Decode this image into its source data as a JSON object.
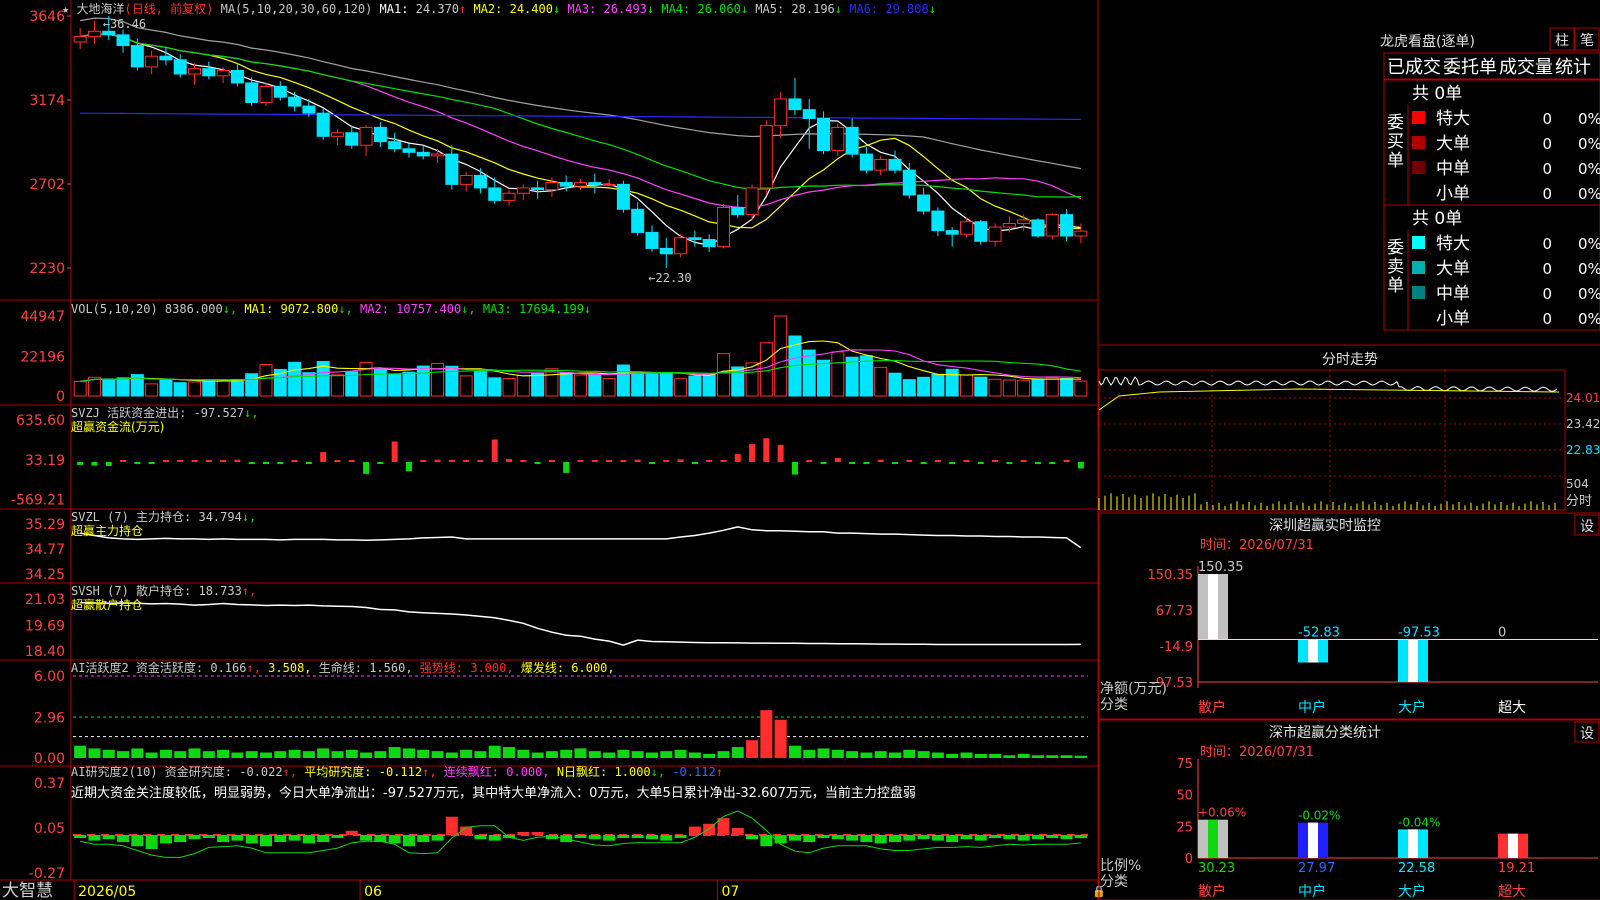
{
  "colors": {
    "up": "#ff2d2d",
    "down": "#00e5ff",
    "green": "#10d810",
    "grid": "#b00000",
    "ma1": "#ffffff",
    "ma2": "#ffff00",
    "ma3": "#ff40ff",
    "ma4": "#00e000",
    "ma5": "#a0a0a0",
    "ma6": "#2a2aff",
    "axis_text": "#ff4040",
    "label": "#c8c8c8",
    "yellow_label": "#ffff00"
  },
  "main_chart": {
    "title_text": "大地海洋",
    "mode_label": "(日线, 前复权)",
    "ma_params": "MA(5,10,20,30,60,120)",
    "ma_values": [
      {
        "name": "MA1:",
        "value": "24.370",
        "arrow": "↑"
      },
      {
        "name": "MA2:",
        "value": "24.400",
        "arrow": "↓"
      },
      {
        "name": "MA3:",
        "value": "26.493",
        "arrow": "↓"
      },
      {
        "name": "MA4:",
        "value": "26.060",
        "arrow": "↓"
      },
      {
        "name": "MA5:",
        "value": "28.196",
        "arrow": "↓"
      },
      {
        "name": "MA6:",
        "value": "29.808",
        "arrow": "↓"
      }
    ],
    "y_ticks": [
      "3646",
      "3174",
      "2702",
      "2230"
    ],
    "y_tick_values": [
      36.46,
      31.74,
      27.02,
      22.3
    ],
    "high_note": "←36.46",
    "low_note": "←22.30"
  },
  "volume": {
    "label": "VOL(5,10,20)",
    "current": "8386.000",
    "current_arrow": "↓",
    "ma_values": [
      {
        "name": "MA1:",
        "value": "9072.800",
        "arrow": "↓"
      },
      {
        "name": "MA2:",
        "value": "10757.400",
        "arrow": "↓"
      },
      {
        "name": "MA3:",
        "value": "17694.199",
        "arrow": "↓"
      }
    ],
    "y_ticks": [
      "44947",
      "22196",
      "0"
    ]
  },
  "svzj": {
    "label": "SVZJ  活跃资金进出:",
    "value": "-97.527",
    "arrow": "↓",
    "suffix": ",",
    "sub_label": "超赢资金流(万元)",
    "y_ticks": [
      "635.60",
      "33.19",
      "-569.21"
    ]
  },
  "svzl": {
    "label": "SVZL (7) 主力持仓:",
    "value": "34.794",
    "arrow": "↓",
    "suffix": ",",
    "sub_label": "超赢主力持仓",
    "y_ticks": [
      "35.29",
      "34.77",
      "34.25"
    ]
  },
  "svsh": {
    "label": "SVSH (7) 散户持仓:",
    "value": "18.733",
    "arrow": "↑",
    "suffix": ",",
    "sub_label": "超赢散户持仓",
    "y_ticks": [
      "21.03",
      "19.69",
      "18.40"
    ]
  },
  "ai_active": {
    "label": "AI活跃度2 资金活跃度:",
    "v1": "0.166",
    "v1_arrow": "↑",
    "v2": "3.508",
    "life_label": "生命线:",
    "life_value": "1.560",
    "strong_label": "强势线:",
    "strong_value": "3.000",
    "burst_label": "爆发线:",
    "burst_value": "6.000",
    "y_ticks": [
      "6.00",
      "2.96",
      "0.00"
    ]
  },
  "ai_research": {
    "label": "AI研究度2(10) 资金研究度:",
    "v1": "-0.022",
    "v1_arrow": "↑",
    "avg_label": "平均研究度:",
    "avg_value": "-0.112",
    "avg_arrow": "↑",
    "red_label": "连续飘红:",
    "red_value": "0.000",
    "nred_label": "N日飘红:",
    "nred_value": "1.000",
    "nred_arrow": "↓",
    "last_value": "-0.112",
    "last_arrow": "↑",
    "comment": "近期大资金关注度较低，明显弱势，今日大单净流出：-97.527万元，其中特大单净流入：0万元，大单5日累计净出-32.607万元，当前主力控盘弱",
    "y_ticks": [
      "0.37",
      "0.05",
      "-0.27"
    ]
  },
  "bottom_bar": {
    "brand": "大智慧",
    "date_labels": [
      "2026/05",
      "06",
      "07"
    ]
  },
  "right_panel": {
    "dragon_title": "龙虎看盘(逐单)",
    "btn_bar": "柱",
    "btn_pen": "笔",
    "tab_labels": [
      "已成交",
      "委托单",
      "成交量",
      "统计"
    ],
    "buy": {
      "side_label": "委买单",
      "total": "共 0单",
      "rows": [
        {
          "name": "特大",
          "count": "0",
          "pct": "0%",
          "color": "#ff0000"
        },
        {
          "name": "大单",
          "count": "0",
          "pct": "0%",
          "color": "#b00000"
        },
        {
          "name": "中单",
          "count": "0",
          "pct": "0%",
          "color": "#700000"
        },
        {
          "name": "小单",
          "count": "0",
          "pct": "0%",
          "color": "#000000"
        }
      ]
    },
    "sell": {
      "side_label": "委卖单",
      "total": "共 0单",
      "rows": [
        {
          "name": "特大",
          "count": "0",
          "pct": "0%",
          "color": "#00ffff"
        },
        {
          "name": "大单",
          "count": "0",
          "pct": "0%",
          "color": "#00b0b0"
        },
        {
          "name": "中单",
          "count": "0",
          "pct": "0%",
          "color": "#008080"
        },
        {
          "name": "小单",
          "count": "0",
          "pct": "0%",
          "color": "#000000"
        }
      ]
    },
    "intraday": {
      "title": "分时走势",
      "price_ticks": [
        "24.01",
        "23.42",
        "22.83"
      ],
      "vol_tick": "504",
      "vol_unit": "分时"
    },
    "monitor": {
      "title": "深圳超赢实时监控",
      "set_btn": "设",
      "time_label": "时间：2026/07/31",
      "y_ticks": [
        "150.35",
        "67.73",
        "-14.9",
        "-97.53"
      ],
      "y_label": "净额(万元)",
      "x_label": "分类",
      "categories": [
        "散户",
        "中户",
        "大户",
        "超大"
      ],
      "values": [
        150.35,
        -52.83,
        -97.53,
        0
      ],
      "value_labels": [
        "150.35",
        "-52.83",
        "-97.53",
        "0"
      ]
    },
    "classify": {
      "title": "深市超赢分类统计",
      "set_btn": "设",
      "time_label": "时间：2026/07/31",
      "y_ticks": [
        "75",
        "50",
        "25",
        "0"
      ],
      "y_label": "比例%",
      "x_label": "分类",
      "categories": [
        "散户",
        "中户",
        "大户",
        "超大"
      ],
      "values": [
        30.23,
        27.97,
        22.58,
        19.21
      ],
      "value_labels": [
        "30.23",
        "27.97",
        "22.58",
        "19.21"
      ],
      "change_labels": [
        "+0.06%",
        "-0.02%",
        "-0.04%",
        ""
      ]
    }
  },
  "chart_data": {
    "type": "candlestick",
    "title": "大地海洋",
    "x_labels": [
      "2026/05",
      "06",
      "07"
    ],
    "ylim": [
      22.3,
      36.46
    ],
    "ohlc": [
      [
        35.0,
        35.8,
        34.6,
        35.3
      ],
      [
        35.3,
        36.2,
        34.9,
        35.6
      ],
      [
        35.6,
        36.46,
        35.1,
        35.4
      ],
      [
        35.4,
        35.7,
        34.4,
        34.8
      ],
      [
        34.8,
        35.2,
        33.4,
        33.6
      ],
      [
        33.6,
        34.5,
        33.2,
        34.2
      ],
      [
        34.2,
        34.7,
        33.7,
        34.0
      ],
      [
        34.0,
        34.3,
        33.0,
        33.2
      ],
      [
        33.2,
        33.8,
        32.6,
        33.5
      ],
      [
        33.5,
        33.9,
        32.9,
        33.1
      ],
      [
        33.1,
        33.6,
        32.7,
        33.4
      ],
      [
        33.4,
        33.8,
        32.5,
        32.7
      ],
      [
        32.7,
        33.0,
        31.4,
        31.6
      ],
      [
        31.6,
        32.7,
        31.4,
        32.5
      ],
      [
        32.5,
        32.8,
        31.7,
        31.9
      ],
      [
        31.9,
        32.2,
        31.1,
        31.4
      ],
      [
        31.4,
        31.8,
        30.8,
        31.0
      ],
      [
        31.0,
        31.3,
        29.5,
        29.7
      ],
      [
        29.7,
        30.1,
        29.2,
        29.9
      ],
      [
        29.9,
        30.3,
        29.0,
        29.2
      ],
      [
        29.2,
        30.3,
        28.6,
        30.2
      ],
      [
        30.2,
        30.5,
        29.1,
        29.4
      ],
      [
        29.4,
        29.9,
        28.8,
        29.0
      ],
      [
        29.0,
        29.3,
        28.5,
        28.8
      ],
      [
        28.8,
        29.2,
        28.4,
        28.6
      ],
      [
        28.6,
        29.0,
        28.2,
        28.7
      ],
      [
        28.7,
        29.2,
        26.7,
        27.0
      ],
      [
        27.0,
        27.7,
        26.6,
        27.5
      ],
      [
        27.5,
        27.9,
        26.5,
        26.8
      ],
      [
        26.8,
        27.4,
        25.9,
        26.1
      ],
      [
        26.1,
        26.7,
        25.8,
        26.5
      ],
      [
        26.5,
        27.0,
        26.1,
        26.8
      ],
      [
        26.8,
        27.2,
        26.2,
        26.7
      ],
      [
        26.7,
        27.4,
        26.3,
        27.1
      ],
      [
        27.1,
        27.5,
        26.6,
        26.9
      ],
      [
        26.9,
        27.3,
        26.7,
        27.1
      ],
      [
        27.1,
        27.6,
        26.5,
        27.0
      ],
      [
        27.0,
        27.3,
        26.9,
        27.0
      ],
      [
        27.0,
        27.2,
        25.4,
        25.6
      ],
      [
        25.6,
        26.0,
        24.1,
        24.3
      ],
      [
        24.3,
        24.7,
        23.2,
        23.4
      ],
      [
        23.4,
        24.0,
        22.3,
        23.1
      ],
      [
        23.1,
        24.2,
        22.9,
        24.0
      ],
      [
        24.0,
        24.4,
        23.5,
        23.9
      ],
      [
        23.9,
        24.2,
        23.2,
        23.5
      ],
      [
        23.5,
        25.9,
        23.4,
        25.7
      ],
      [
        25.7,
        26.4,
        25.1,
        25.3
      ],
      [
        25.3,
        27.0,
        25.0,
        26.8
      ],
      [
        26.8,
        30.6,
        26.4,
        30.3
      ],
      [
        30.3,
        32.2,
        29.6,
        31.8
      ],
      [
        31.8,
        33.0,
        30.9,
        31.2
      ],
      [
        31.2,
        31.8,
        29.0,
        30.7
      ],
      [
        30.7,
        31.1,
        28.7,
        28.9
      ],
      [
        28.9,
        30.4,
        28.6,
        30.2
      ],
      [
        30.2,
        30.7,
        28.5,
        28.7
      ],
      [
        28.7,
        29.1,
        27.6,
        27.8
      ],
      [
        27.8,
        28.6,
        27.5,
        28.4
      ],
      [
        28.4,
        28.9,
        27.6,
        27.8
      ],
      [
        27.8,
        28.2,
        26.2,
        26.4
      ],
      [
        26.4,
        26.8,
        25.3,
        25.5
      ],
      [
        25.5,
        25.7,
        24.1,
        24.4
      ],
      [
        24.4,
        24.6,
        23.5,
        24.2
      ],
      [
        24.2,
        25.1,
        24.0,
        24.9
      ],
      [
        24.9,
        25.0,
        23.6,
        23.8
      ],
      [
        23.8,
        24.8,
        23.5,
        24.6
      ],
      [
        24.6,
        25.2,
        24.3,
        24.8
      ],
      [
        24.8,
        25.3,
        24.4,
        25.0
      ],
      [
        25.0,
        25.1,
        24.0,
        24.1
      ],
      [
        24.1,
        25.4,
        23.9,
        25.3
      ],
      [
        25.3,
        25.6,
        23.8,
        24.1
      ],
      [
        24.1,
        24.8,
        23.7,
        24.37
      ]
    ],
    "volume": [
      8200,
      10500,
      9600,
      10200,
      12000,
      6800,
      9300,
      7500,
      7900,
      9100,
      8400,
      9300,
      12500,
      17700,
      14900,
      18900,
      13100,
      19400,
      11900,
      13600,
      18800,
      15500,
      12100,
      13400,
      16800,
      18300,
      16700,
      11300,
      13700,
      10200,
      9800,
      11500,
      12700,
      15300,
      13100,
      11800,
      12100,
      9800,
      17400,
      13000,
      12300,
      12800,
      9700,
      11200,
      12100,
      23800,
      16300,
      18600,
      29900,
      44947,
      33700,
      25800,
      20100,
      24800,
      21800,
      22600,
      16100,
      12800,
      9200,
      10500,
      12200,
      15000,
      11800,
      10600,
      9400,
      9000,
      8900,
      9600,
      10300,
      9900,
      8386
    ],
    "svzj": [
      -45,
      -55,
      -60,
      0,
      -20,
      -15,
      20,
      25,
      30,
      25,
      30,
      35,
      -30,
      -25,
      -10,
      30,
      -15,
      150,
      20,
      25,
      -180,
      -25,
      310,
      -140,
      20,
      35,
      25,
      20,
      30,
      340,
      45,
      25,
      -20,
      20,
      -165,
      15,
      30,
      25,
      20,
      35,
      -20,
      30,
      40,
      -10,
      25,
      30,
      120,
      270,
      360,
      260,
      -190,
      15,
      -20,
      60,
      -25,
      -20,
      35,
      -20,
      30,
      -25,
      25,
      -20,
      25,
      -25,
      30,
      -20,
      20,
      -20,
      -25,
      20,
      -97.527
    ],
    "svzl": [
      35.1,
      35.05,
      35.0,
      34.98,
      34.97,
      34.98,
      34.99,
      34.98,
      34.98,
      34.97,
      34.98,
      34.97,
      34.97,
      34.97,
      34.96,
      34.97,
      34.97,
      34.97,
      34.96,
      34.96,
      34.95,
      34.96,
      34.97,
      34.98,
      35.0,
      35.01,
      35.02,
      34.98,
      34.98,
      34.98,
      34.98,
      34.98,
      34.98,
      34.98,
      34.98,
      34.98,
      34.98,
      34.98,
      34.98,
      34.98,
      34.98,
      34.98,
      35.02,
      35.05,
      35.1,
      35.16,
      35.23,
      35.17,
      35.15,
      35.15,
      35.14,
      35.13,
      35.13,
      35.1,
      35.1,
      35.09,
      35.08,
      35.08,
      35.07,
      35.06,
      35.05,
      35.05,
      35.04,
      35.04,
      35.03,
      35.03,
      35.02,
      35.02,
      35.01,
      35.0,
      34.794
    ],
    "svsh": [
      20.85,
      20.83,
      20.82,
      20.83,
      20.82,
      20.78,
      20.8,
      20.77,
      20.72,
      20.75,
      20.8,
      20.75,
      20.73,
      20.7,
      20.72,
      20.7,
      20.72,
      20.68,
      20.66,
      20.65,
      20.6,
      20.5,
      20.48,
      20.38,
      20.33,
      20.3,
      20.27,
      20.22,
      20.15,
      20.08,
      19.95,
      19.8,
      19.55,
      19.35,
      19.2,
      19.15,
      19.0,
      18.9,
      18.7,
      18.95,
      18.88,
      18.87,
      18.85,
      18.83,
      18.82,
      18.82,
      18.81,
      18.8,
      18.8,
      18.79,
      18.79,
      18.78,
      18.78,
      18.77,
      18.77,
      18.76,
      18.75,
      18.75,
      18.74,
      18.74,
      18.73,
      18.73,
      18.73,
      18.73,
      18.73,
      18.73,
      18.73,
      18.73,
      18.73,
      18.73,
      18.733
    ],
    "ai_active": [
      0.9,
      0.7,
      0.6,
      0.5,
      0.7,
      0.4,
      0.6,
      0.5,
      0.7,
      0.5,
      0.6,
      0.4,
      0.5,
      0.4,
      0.5,
      0.6,
      0.5,
      0.7,
      0.5,
      0.6,
      0.4,
      0.5,
      0.8,
      0.7,
      0.6,
      0.5,
      0.4,
      0.6,
      0.5,
      0.9,
      0.8,
      0.6,
      0.4,
      0.5,
      0.6,
      0.7,
      0.5,
      0.4,
      0.6,
      0.5,
      0.4,
      0.5,
      0.6,
      0.4,
      0.3,
      0.5,
      0.8,
      1.3,
      3.5,
      2.8,
      0.9,
      0.6,
      0.7,
      0.6,
      0.5,
      0.4,
      0.5,
      0.4,
      0.6,
      0.5,
      0.4,
      0.3,
      0.4,
      0.3,
      0.3,
      0.2,
      0.3,
      0.2,
      0.2,
      0.2,
      0.166
    ],
    "ai_research": [
      -0.02,
      -0.04,
      -0.03,
      -0.05,
      -0.08,
      -0.1,
      -0.06,
      -0.05,
      -0.03,
      -0.02,
      -0.05,
      -0.04,
      -0.06,
      -0.08,
      -0.05,
      -0.04,
      -0.06,
      -0.05,
      -0.02,
      0.03,
      -0.04,
      -0.05,
      -0.06,
      -0.08,
      -0.05,
      -0.04,
      0.13,
      0.06,
      -0.03,
      -0.04,
      -0.02,
      0.02,
      0.01,
      -0.03,
      -0.05,
      -0.02,
      -0.03,
      -0.04,
      -0.02,
      -0.01,
      -0.03,
      -0.04,
      -0.02,
      0.06,
      0.08,
      0.12,
      0.05,
      -0.03,
      -0.08,
      -0.06,
      -0.04,
      -0.05,
      -0.02,
      -0.03,
      -0.04,
      -0.05,
      -0.06,
      -0.05,
      -0.04,
      -0.03,
      -0.04,
      -0.05,
      -0.03,
      -0.04,
      -0.02,
      -0.03,
      -0.04,
      -0.03,
      -0.02,
      -0.03,
      -0.022
    ]
  }
}
